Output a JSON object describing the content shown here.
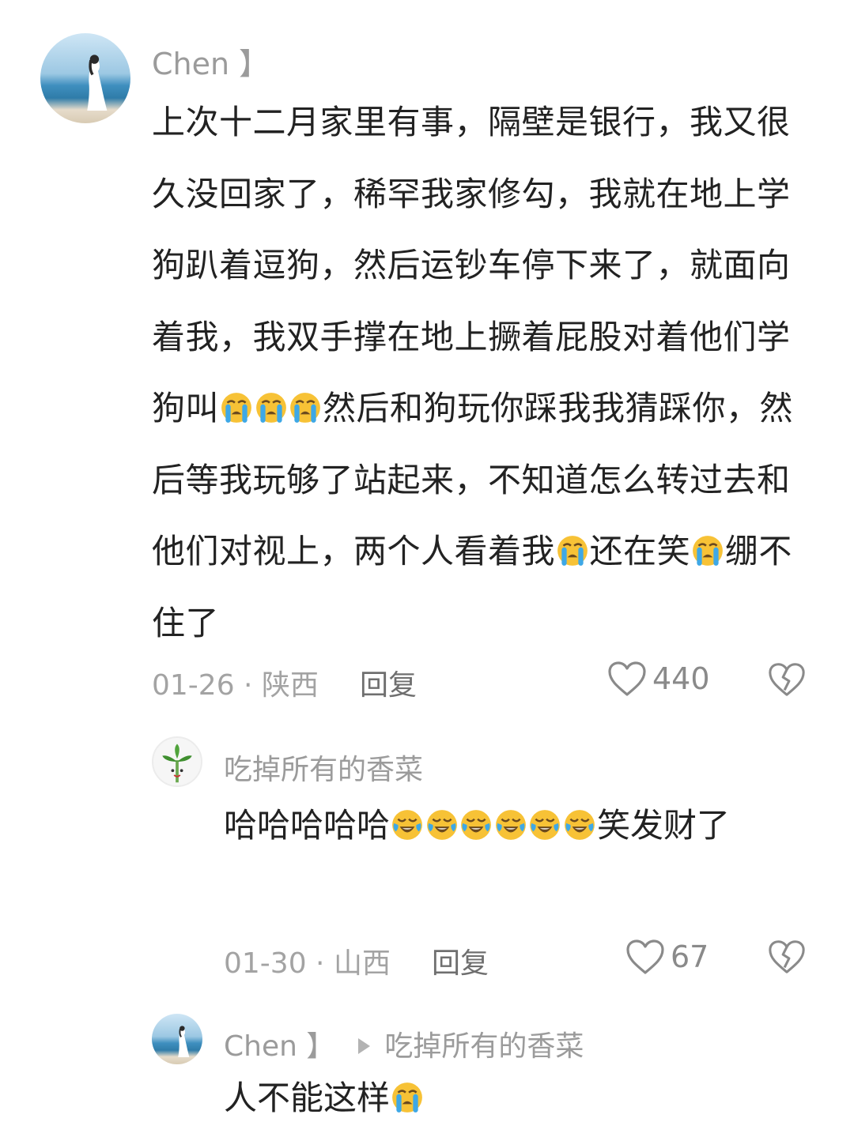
{
  "comments": [
    {
      "username": "Chen 】",
      "text_parts": [
        "上次十二月家里有事，隔壁是银行，我又很久没回家了，稀罕我家修勾，我就在地上学狗趴着逗狗，然后运钞车停下来了，就面向着我，我双手撑在地上撅着屁股对着他们学狗叫",
        "然后和狗玩你踩我我猜踩你，然后等我玩够了站起来，不知道怎么转过去和他们对视上，两个人看着我",
        "还在笑",
        "绷不住了"
      ],
      "emoji": "loudly-crying-face",
      "date_location": "01-26 · 陕西",
      "reply_label": "回复",
      "likes": "440"
    },
    {
      "username": "吃掉所有的香菜",
      "text_parts": [
        "哈哈哈哈哈",
        "笑发财了"
      ],
      "emoji": "laughing-crying-face",
      "date_location": "01-30 · 山西",
      "reply_label": "回复",
      "likes": "67"
    },
    {
      "username": "Chen 】",
      "reply_to": "吃掉所有的香菜",
      "text_parts": [
        "人不能这样"
      ],
      "emoji": "loudly-crying-face"
    }
  ],
  "colors": {
    "text": "#222222",
    "muted": "#9b9b9b",
    "icon": "#8a8a8a",
    "emoji_face": "#f7c236",
    "emoji_tear": "#3ea8e6"
  }
}
